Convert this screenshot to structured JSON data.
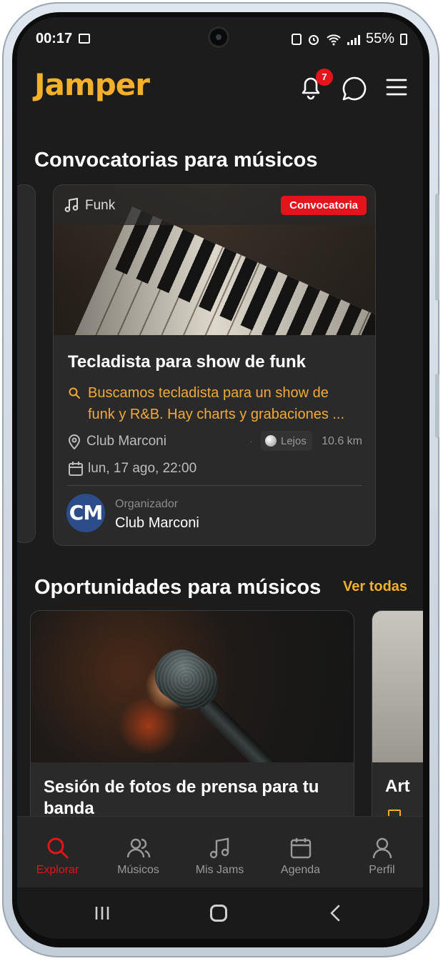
{
  "status_bar": {
    "time": "00:17",
    "battery": "55%"
  },
  "app_bar": {
    "logo": "Jamper",
    "notification_count": "7"
  },
  "section_calls": {
    "title": "Convocatorias para músicos",
    "card": {
      "genre": "Funk",
      "badge": "Convocatoria",
      "title": "Tecladista para show de funk",
      "description": "Buscamos tecladista para un show de\nfunk y R&B. Hay charts y grabaciones ...",
      "venue": "Club Marconi",
      "distance_label": "Lejos",
      "distance": "10.6 km",
      "datetime": "lun, 17 ago, 22:00",
      "organizer_label": "Organizador",
      "organizer_initials": "CM",
      "organizer_name": "Club Marconi"
    }
  },
  "section_opportunities": {
    "title": "Oportunidades para músicos",
    "see_all": "Ver todas",
    "cards": [
      {
        "title": "Sesión de fotos de prensa para tu banda"
      },
      {
        "title": "Art"
      }
    ]
  },
  "bottom_nav": [
    {
      "label": "Explorar",
      "icon": "search-icon",
      "active": true
    },
    {
      "label": "Músicos",
      "icon": "users-icon",
      "active": false
    },
    {
      "label": "Mis Jams",
      "icon": "music-note-icon",
      "active": false
    },
    {
      "label": "Agenda",
      "icon": "calendar-icon",
      "active": false
    },
    {
      "label": "Perfil",
      "icon": "user-icon",
      "active": false
    }
  ],
  "colors": {
    "accent": "#f2b02b",
    "badge_red": "#e3141b",
    "background": "#1c1c1c",
    "card": "#2a2a2a"
  }
}
